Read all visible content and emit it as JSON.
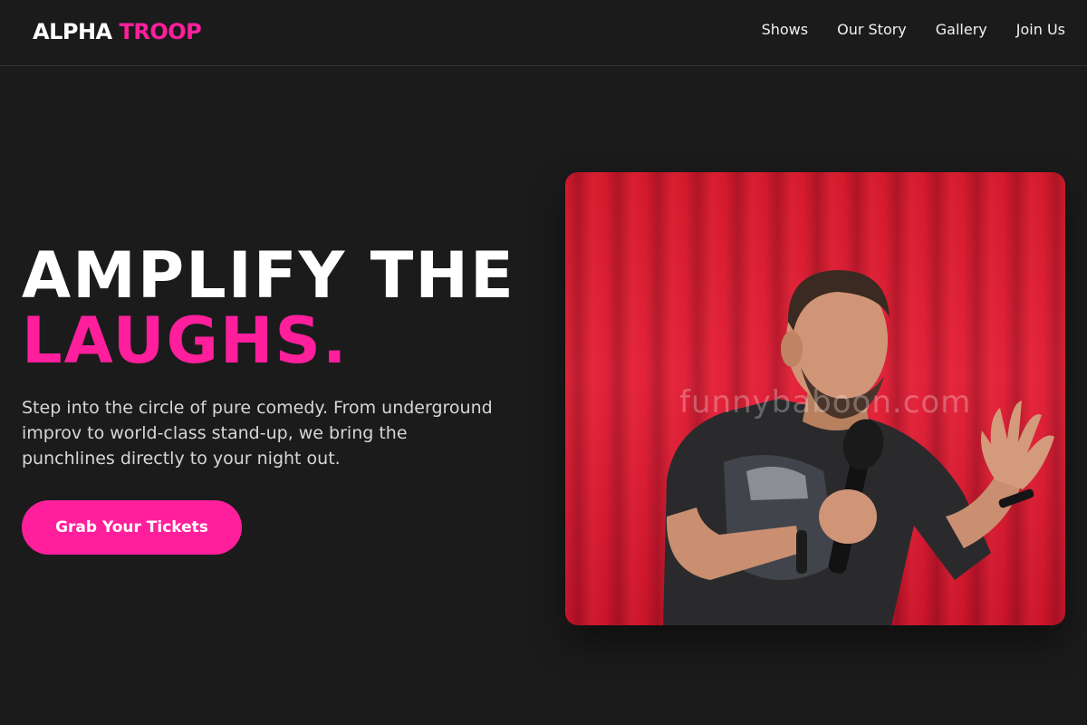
{
  "brand": {
    "part1": "ALPHA",
    "part2": "TROOP",
    "accent_color": "#ff1f9c"
  },
  "nav": {
    "items": [
      {
        "label": "Shows"
      },
      {
        "label": "Our Story"
      },
      {
        "label": "Gallery"
      },
      {
        "label": "Join Us"
      }
    ]
  },
  "hero": {
    "title_line1": "AMPLIFY THE",
    "title_line2": "LAUGHS.",
    "description": "Step into the circle of pure comedy. From underground improv to world-class stand-up, we bring the punchlines directly to your night out.",
    "cta_label": "Grab Your Tickets",
    "image": {
      "subject": "comedian-with-microphone",
      "watermark": "funnybaboon.com"
    }
  },
  "colors": {
    "background": "#1b1b1c",
    "curtain": "#d3192c"
  }
}
